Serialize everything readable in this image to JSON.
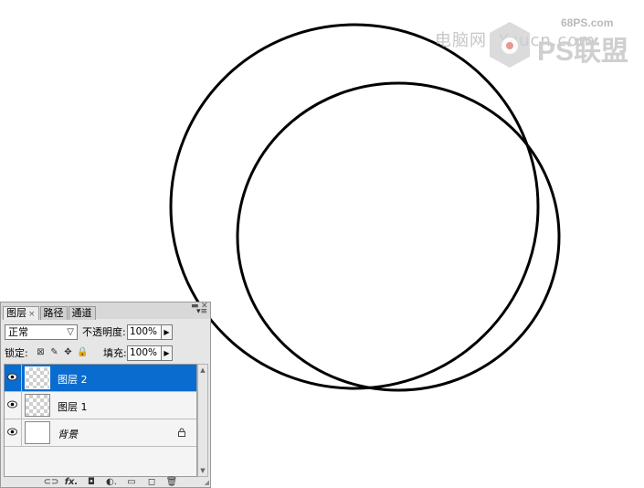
{
  "watermark": {
    "site": "68PS.com",
    "chinese": "电脑网",
    "logo_text": "PS联盟",
    "overlay_url": "Yuucn.com"
  },
  "panel": {
    "tabs": [
      {
        "label": "图层",
        "close": "×",
        "active": true
      },
      {
        "label": "路径",
        "active": false
      },
      {
        "label": "通道",
        "active": false
      }
    ],
    "blend_mode": "正常",
    "opacity_label": "不透明度:",
    "opacity_value": "100%",
    "lock_label": "锁定:",
    "fill_label": "填充:",
    "fill_value": "100%",
    "layers": [
      {
        "name": "图层 2",
        "selected": true,
        "visible": true
      },
      {
        "name": "图层 1",
        "selected": false,
        "visible": true
      },
      {
        "name": "背景",
        "selected": false,
        "visible": true,
        "locked": true
      }
    ],
    "bottom_icons": [
      "link-icon",
      "fx-icon",
      "mask-icon",
      "adjustment-icon",
      "group-icon",
      "new-layer-icon",
      "trash-icon"
    ],
    "bottom_glyphs": [
      "⊂⊃",
      "fx.",
      "◘",
      "◐.",
      "▭",
      "◻",
      "🗑"
    ]
  },
  "colors": {
    "selection": "#0a6ccf",
    "panel_bg": "#e6e6e6",
    "circle_stroke": "#000000"
  }
}
